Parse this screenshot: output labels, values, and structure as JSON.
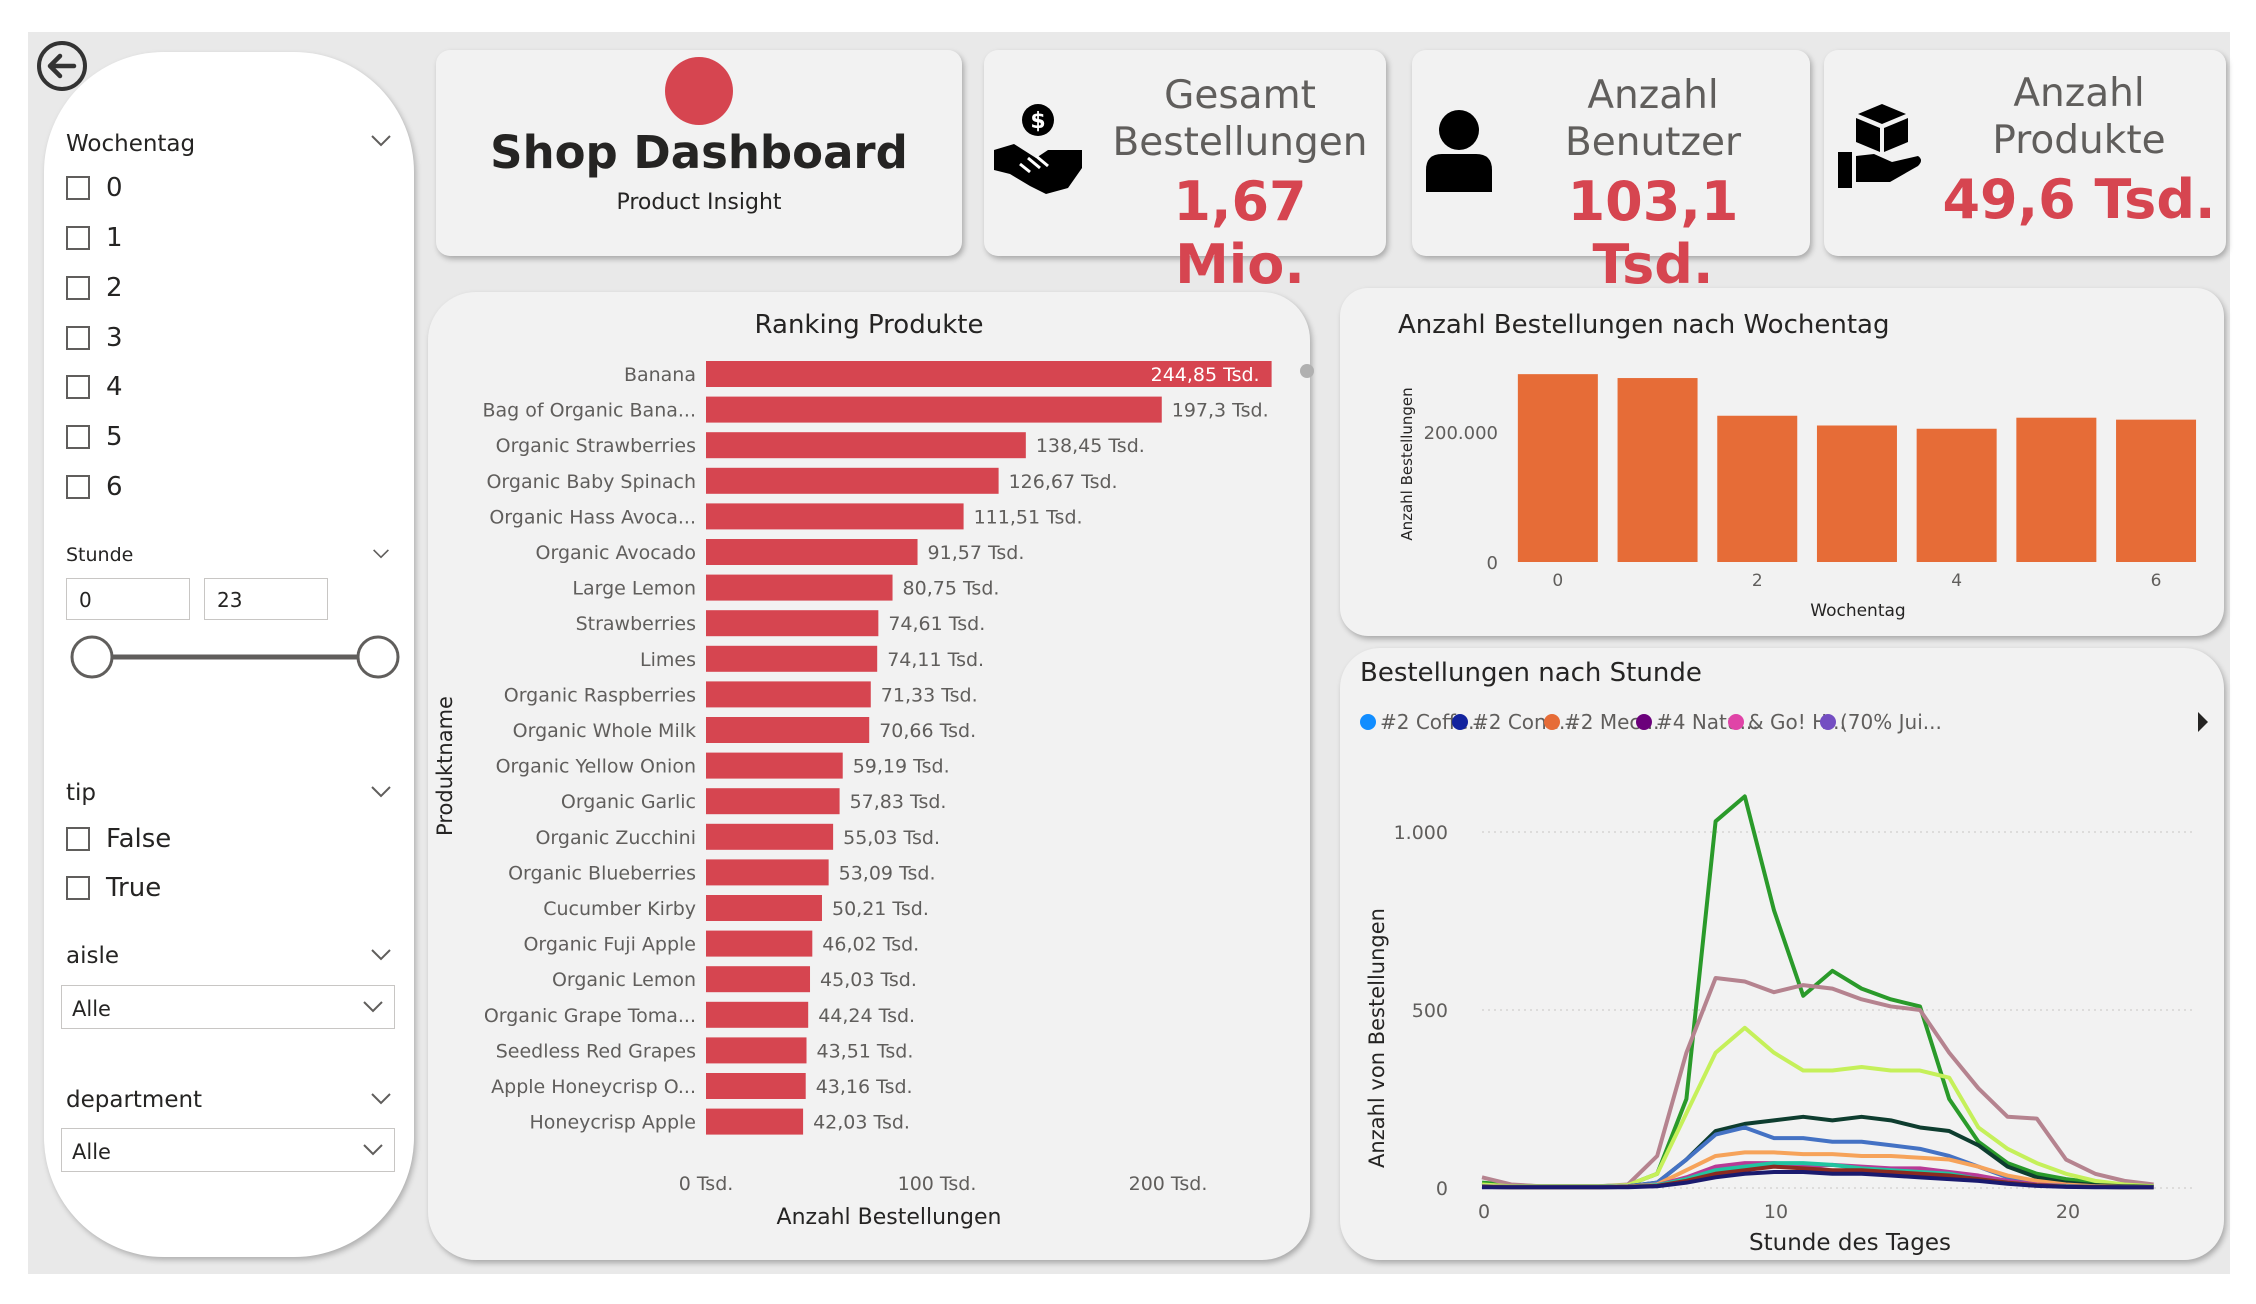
{
  "header": {
    "title": "Shop Dashboard",
    "subtitle": "Product Insight",
    "logo_color": "#d64550"
  },
  "kpis": [
    {
      "title_lines": [
        "Gesamt",
        "Bestellungen"
      ],
      "value": "1,67 Mio.",
      "icon": "handshake-dollar-icon"
    },
    {
      "title_lines": [
        "Anzahl",
        "Benutzer"
      ],
      "value": "103,1 Tsd.",
      "icon": "user-icon"
    },
    {
      "title_lines": [
        "Anzahl",
        "Produkte"
      ],
      "value": "49,6 Tsd.",
      "icon": "hand-box-icon"
    }
  ],
  "filters": {
    "wochentag": {
      "title": "Wochentag",
      "options": [
        "0",
        "1",
        "2",
        "3",
        "4",
        "5",
        "6"
      ]
    },
    "stunde": {
      "title": "Stunde",
      "min": "0",
      "max": "23",
      "range_fraction": [
        0,
        1
      ]
    },
    "tip": {
      "title": "tip",
      "options": [
        "False",
        "True"
      ]
    },
    "aisle": {
      "title": "aisle",
      "value": "Alle"
    },
    "department": {
      "title": "department",
      "value": "Alle"
    }
  },
  "chart_data": [
    {
      "type": "bar",
      "orientation": "horizontal",
      "title": "Ranking Produkte",
      "xlabel": "Anzahl Bestellungen",
      "ylabel": "Produktname",
      "xlim": [
        0,
        250000
      ],
      "xticks": [
        "0 Tsd.",
        "100 Tsd.",
        "200 Tsd."
      ],
      "xtick_values": [
        0,
        100000,
        200000
      ],
      "color": "#d64550",
      "categories": [
        "Banana",
        "Bag of Organic Bana...",
        "Organic Strawberries",
        "Organic Baby Spinach",
        "Organic Hass Avoca...",
        "Organic Avocado",
        "Large Lemon",
        "Strawberries",
        "Limes",
        "Organic Raspberries",
        "Organic Whole Milk",
        "Organic Yellow Onion",
        "Organic Garlic",
        "Organic Zucchini",
        "Organic Blueberries",
        "Cucumber Kirby",
        "Organic Fuji Apple",
        "Organic Lemon",
        "Organic Grape Toma...",
        "Seedless Red Grapes",
        "Apple Honeycrisp O...",
        "Honeycrisp Apple"
      ],
      "values": [
        244850,
        197300,
        138450,
        126670,
        111510,
        91570,
        80750,
        74610,
        74110,
        71330,
        70660,
        59190,
        57830,
        55030,
        53090,
        50210,
        46020,
        45030,
        44240,
        43510,
        43160,
        42030
      ],
      "labels": [
        "244,85 Tsd.",
        "197,3 Tsd.",
        "138,45 Tsd.",
        "126,67 Tsd.",
        "111,51 Tsd.",
        "91,57 Tsd.",
        "80,75 Tsd.",
        "74,61 Tsd.",
        "74,11 Tsd.",
        "71,33 Tsd.",
        "70,66 Tsd.",
        "59,19 Tsd.",
        "57,83 Tsd.",
        "55,03 Tsd.",
        "53,09 Tsd.",
        "50,21 Tsd.",
        "46,02 Tsd.",
        "45,03 Tsd.",
        "44,24 Tsd.",
        "43,51 Tsd.",
        "43,16 Tsd.",
        "42,03 Tsd."
      ]
    },
    {
      "type": "bar",
      "title": "Anzahl Bestellungen nach Wochentag",
      "xlabel": "Wochentag",
      "ylabel": "Anzahl Bestellungen",
      "ylim": [
        0,
        300000
      ],
      "yticks": [
        0,
        200000
      ],
      "ytick_labels": [
        "0",
        "200.000"
      ],
      "xtick_labels": [
        "0",
        "2",
        "4",
        "6"
      ],
      "xtick_values": [
        0,
        2,
        4,
        6
      ],
      "color": "#e66c37",
      "categories": [
        0,
        1,
        2,
        3,
        4,
        5,
        6
      ],
      "values": [
        289000,
        283000,
        225000,
        210000,
        205000,
        222000,
        219000
      ]
    },
    {
      "type": "line",
      "title": "Bestellungen nach Stunde",
      "xlabel": "Stunde des Tages",
      "ylabel": "Anzahl von Bestellungen",
      "xlim": [
        0,
        24
      ],
      "ylim": [
        0,
        1200
      ],
      "xticks": [
        0,
        10,
        20
      ],
      "yticks": [
        0,
        500,
        1000
      ],
      "ytick_labels": [
        "0",
        "500",
        "1.000"
      ],
      "legend": [
        "#2 Coffe...",
        "#2 Cone...",
        "#2 Mec...",
        "#4 Natu...",
        "& Go! H...",
        "(70% Jui..."
      ],
      "legend_colors": [
        "#118dff",
        "#12239e",
        "#e66c37",
        "#6b007b",
        "#e044a7",
        "#744ec2"
      ],
      "x": [
        0,
        1,
        2,
        3,
        4,
        5,
        6,
        7,
        8,
        9,
        10,
        11,
        12,
        13,
        14,
        15,
        16,
        17,
        18,
        19,
        20,
        21,
        22,
        23
      ],
      "series": [
        {
          "color": "#2a9a2a",
          "values": [
            15,
            8,
            5,
            5,
            5,
            8,
            40,
            250,
            1030,
            1100,
            780,
            540,
            610,
            560,
            530,
            510,
            250,
            130,
            70,
            40,
            25,
            15,
            10,
            5
          ]
        },
        {
          "color": "#b5838f",
          "values": [
            30,
            10,
            5,
            5,
            5,
            10,
            90,
            380,
            590,
            580,
            550,
            570,
            560,
            530,
            510,
            500,
            380,
            280,
            200,
            195,
            80,
            40,
            20,
            10
          ]
        },
        {
          "color": "#c5f05a",
          "values": [
            10,
            5,
            5,
            5,
            5,
            8,
            40,
            210,
            380,
            450,
            380,
            330,
            330,
            340,
            330,
            330,
            310,
            170,
            110,
            70,
            40,
            20,
            10,
            5
          ]
        },
        {
          "color": "#0e3d2f",
          "values": [
            5,
            3,
            3,
            3,
            3,
            5,
            15,
            80,
            160,
            180,
            190,
            200,
            190,
            200,
            190,
            170,
            160,
            120,
            60,
            30,
            15,
            8,
            5,
            3
          ]
        },
        {
          "color": "#4472c4",
          "values": [
            5,
            3,
            3,
            3,
            3,
            5,
            15,
            80,
            150,
            170,
            140,
            140,
            130,
            130,
            120,
            110,
            90,
            60,
            30,
            15,
            8,
            5,
            3,
            2
          ]
        },
        {
          "color": "#f6a35a",
          "values": [
            4,
            3,
            2,
            2,
            2,
            4,
            10,
            50,
            90,
            100,
            100,
            95,
            95,
            90,
            90,
            85,
            80,
            60,
            35,
            20,
            10,
            5,
            3,
            2
          ]
        },
        {
          "color": "#b83a96",
          "values": [
            3,
            2,
            2,
            2,
            2,
            3,
            8,
            30,
            60,
            70,
            70,
            60,
            65,
            60,
            55,
            55,
            45,
            35,
            20,
            10,
            6,
            3,
            2,
            2
          ]
        },
        {
          "color": "#21c4a0",
          "values": [
            3,
            2,
            2,
            2,
            2,
            3,
            8,
            25,
            50,
            60,
            70,
            70,
            65,
            55,
            50,
            45,
            40,
            25,
            15,
            8,
            5,
            3,
            2,
            2
          ]
        },
        {
          "color": "#8c2a20",
          "values": [
            3,
            2,
            2,
            2,
            2,
            3,
            6,
            20,
            40,
            50,
            60,
            55,
            50,
            50,
            45,
            40,
            35,
            25,
            15,
            8,
            4,
            3,
            2,
            2
          ]
        },
        {
          "color": "#1a1a6e",
          "values": [
            2,
            2,
            2,
            2,
            2,
            2,
            5,
            15,
            30,
            40,
            45,
            45,
            40,
            40,
            35,
            30,
            25,
            20,
            12,
            6,
            3,
            2,
            2,
            2
          ]
        }
      ]
    }
  ]
}
